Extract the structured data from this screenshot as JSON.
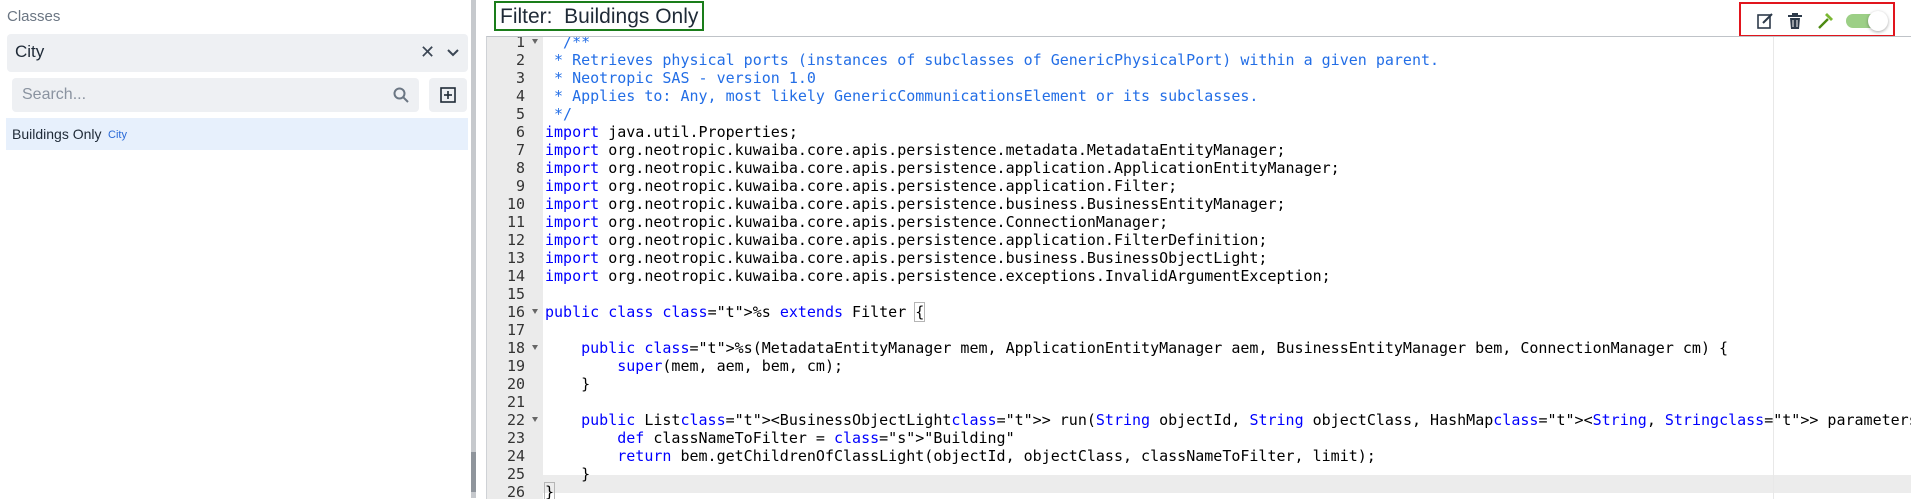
{
  "sidebar": {
    "classes_label": "Classes",
    "class_combo_value": "City",
    "search_placeholder": "Search...",
    "items": [
      {
        "name": "Buildings Only",
        "class": "City"
      }
    ]
  },
  "filter": {
    "title": "Filter:  Buildings Only"
  },
  "toolbar": {
    "buttons": [
      "edit-icon",
      "trash-icon",
      "hammer-icon"
    ],
    "toggle_enabled": true,
    "accent_color": "#9ccf86",
    "highlight_color": "#e1151d"
  },
  "editor": {
    "line_numbers": [
      "1",
      "2",
      "3",
      "4",
      "5",
      "6",
      "7",
      "8",
      "9",
      "10",
      "11",
      "12",
      "13",
      "14",
      "15",
      "16",
      "17",
      "18",
      "19",
      "20",
      "21",
      "22",
      "23",
      "24",
      "25",
      "26"
    ],
    "lines": [
      "  /**",
      " * Retrieves physical ports (instances of subclasses of GenericPhysicalPort) within a given parent.",
      " * Neotropic SAS - version 1.0",
      " * Applies to: Any, most likely GenericCommunicationsElement or its subclasses.",
      " */",
      "import java.util.Properties;",
      "import org.neotropic.kuwaiba.core.apis.persistence.metadata.MetadataEntityManager;",
      "import org.neotropic.kuwaiba.core.apis.persistence.application.ApplicationEntityManager;",
      "import org.neotropic.kuwaiba.core.apis.persistence.application.Filter;",
      "import org.neotropic.kuwaiba.core.apis.persistence.business.BusinessEntityManager;",
      "import org.neotropic.kuwaiba.core.apis.persistence.ConnectionManager;",
      "import org.neotropic.kuwaiba.core.apis.persistence.application.FilterDefinition;",
      "import org.neotropic.kuwaiba.core.apis.persistence.business.BusinessObjectLight;",
      "import org.neotropic.kuwaiba.core.apis.persistence.exceptions.InvalidArgumentException;",
      "",
      "public class %s extends Filter {",
      "",
      "    public %s(MetadataEntityManager mem, ApplicationEntityManager aem, BusinessEntityManager bem, ConnectionManager cm) {",
      "        super(mem, aem, bem, cm);",
      "    }",
      "",
      "    public List<BusinessObjectLight> run(String objectId, String objectClass, HashMap<String, String> parameters, int page, int limit) throws Inval",
      "        def classNameToFilter = \"Building\"",
      "        return bem.getChildrenOfClassLight(objectId, objectClass, classNameToFilter, limit);",
      "    }",
      "}"
    ]
  }
}
